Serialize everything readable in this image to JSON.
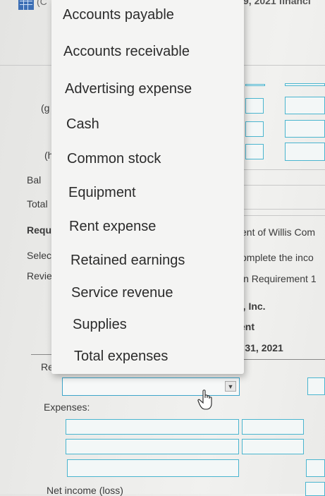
{
  "header": {
    "paren_fragment": "(C",
    "title_fragment": "9, 2021 financi"
  },
  "background": {
    "row_g": "(g",
    "row_h": "(h",
    "bal": "Bal",
    "total": "Total",
    "requirement": "Requi",
    "select": "Select",
    "review": "Reviev",
    "right_line1": "ent of Willis Com",
    "right_line2": "omplete the inco",
    "right_line3": "in Requirement 1",
    "company_fragment": "), Inc.",
    "statement_fragment": "ent",
    "date_fragment": "r 31, 2021",
    "revenue": "Reve",
    "expenses": "Expenses:",
    "net_income": "Net income (loss)"
  },
  "dropdown": {
    "options": [
      "Accounts payable",
      "Accounts receivable",
      "Advertising expense",
      "Cash",
      "Common stock",
      "Equipment",
      "Rent expense",
      "Retained earnings",
      "Service revenue",
      "Supplies",
      "Total expenses"
    ],
    "selected_value": ""
  },
  "colors": {
    "input_border": "#4ab5cf",
    "menu_background": "#f4f4f3",
    "page_background": "#ececea"
  },
  "icons": {
    "spreadsheet": "spreadsheet-icon",
    "dropdown_arrow": "chevron-down-icon",
    "cursor": "hand-pointer-icon"
  }
}
